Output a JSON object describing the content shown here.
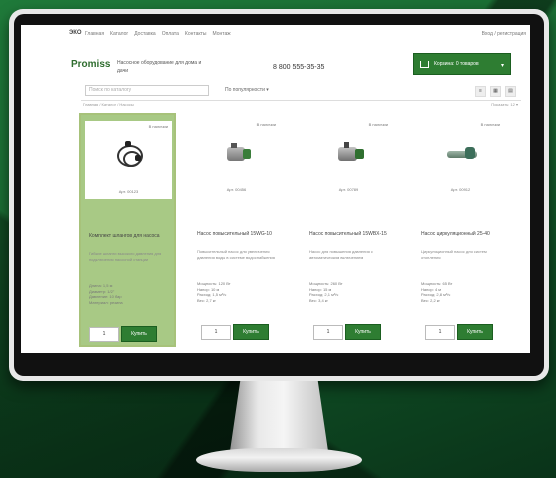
{
  "topnav": {
    "logo": "ЭКО",
    "items": [
      "Главная",
      "Каталог",
      "Доставка",
      "Оплата",
      "Контакты",
      "Монтаж"
    ],
    "login": "Вход / регистрация"
  },
  "header": {
    "brand": "Promiss",
    "tagline": "Насосное оборудование для дома и дачи",
    "phone": "8 800 555-35-35",
    "cart_label": "Корзина: 0 товаров",
    "cart_caret": "▾"
  },
  "toolbar": {
    "search_placeholder": "Поиск по каталогу",
    "sort_label": "По популярности ▾",
    "view_buttons": [
      "≡",
      "▦",
      "▤"
    ],
    "crumb_left": "Главная / Каталог / Насосы",
    "crumb_right": "Показать: 12 ▾"
  },
  "products": [
    {
      "tag": "В наличии",
      "sku": "Арт. 00123",
      "title": "Комплект шлангов для насоса",
      "desc": "Гибкие шланги высокого давления для подключения насосной станции",
      "specs": "Длина: 1,5 м\nДиаметр: 1/2\"\nДавление: 10 бар\nМатериал: резина",
      "qty": "1",
      "buy": "Купить"
    },
    {
      "tag": "В наличии",
      "sku": "Арт. 00456",
      "title": "Насос повысительный 15WG-10",
      "desc": "Повысительный насос для увеличения давления воды в системе водоснабжения",
      "specs": "Мощность: 120 Вт\nНапор: 10 м\nРасход: 1,5 м³/ч\nВес: 2,7 кг",
      "qty": "1",
      "buy": "Купить"
    },
    {
      "tag": "В наличии",
      "sku": "Арт. 00789",
      "title": "Насос повысительный 15WBX-15",
      "desc": "Насос для повышения давления с автоматическим включением",
      "specs": "Мощность: 260 Вт\nНапор: 15 м\nРасход: 2,1 м³/ч\nВес: 3,4 кг",
      "qty": "1",
      "buy": "Купить"
    },
    {
      "tag": "В наличии",
      "sku": "Арт. 00912",
      "title": "Насос циркуляционный 25-40",
      "desc": "Циркуляционный насос для систем отопления",
      "specs": "Мощность: 65 Вт\nНапор: 4 м\nРасход: 2,8 м³/ч\nВес: 2,2 кг",
      "qty": "1",
      "buy": "Купить"
    }
  ],
  "colors": {
    "accent": "#2e7d32",
    "active_card": "#a8c985",
    "background": "#1a6b33"
  }
}
